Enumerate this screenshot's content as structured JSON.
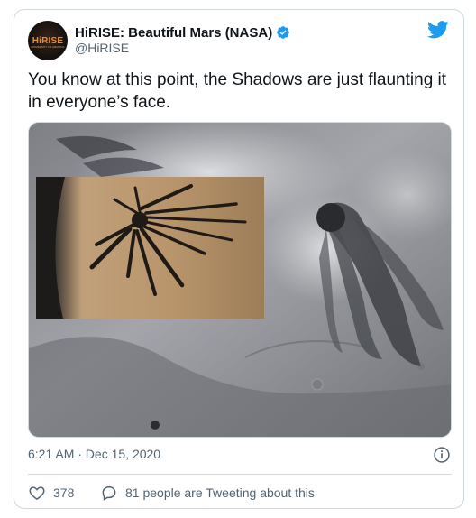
{
  "colors": {
    "accent": "#1d9bf0",
    "text_primary": "#0f1419",
    "text_secondary": "#536471",
    "border": "#cfd9de"
  },
  "author": {
    "display_name": "HiRISE: Beautiful Mars (NASA)",
    "handle": "@HiRISE",
    "avatar_logo_text": "HiRISE",
    "avatar_logo_tag": "UNIVERSITY OF ARIZONA",
    "verified": true
  },
  "icons": {
    "platform": "twitter-bird-icon",
    "verified": "verified-badge-icon",
    "info": "info-icon",
    "like": "heart-icon",
    "reply": "speech-bubble-icon"
  },
  "tweet": {
    "text": "You know at this point, the Shadows are just flaunting it in everyone’s face.",
    "timestamp": "6:21 AM · Dec 15, 2020"
  },
  "engagement": {
    "likes": "378",
    "conversation": "81 people are Tweeting about this"
  }
}
